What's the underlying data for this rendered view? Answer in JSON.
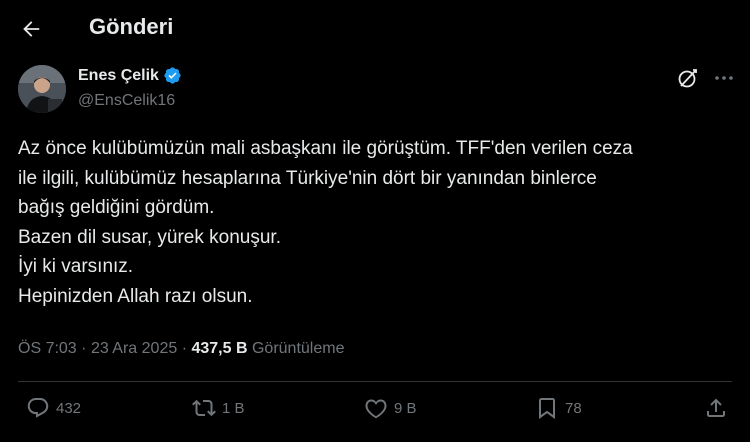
{
  "header": {
    "title": "Gönderi"
  },
  "author": {
    "name": "Enes Çelik",
    "handle": "@EnsCelik16"
  },
  "tweet": {
    "lines": [
      "Az önce kulübümüzün mali asbaşkanı ile görüştüm. TFF'den verilen ceza",
      "ile ilgili, kulübümüz hesaplarına Türkiye'nin dört bir yanından binlerce",
      "bağış geldiğini gördüm.",
      "Bazen dil susar, yürek konuşur.",
      "İyi ki varsınız.",
      "Hepinizden Allah razı olsun."
    ]
  },
  "meta": {
    "time": "ÖS 7:03",
    "separator": "·",
    "date": "23 Ara 2025",
    "views_count": "437,5 B",
    "views_label": "Görüntüleme"
  },
  "actions": {
    "replies": "432",
    "reposts": "1 B",
    "likes": "9 B",
    "bookmarks": "78"
  },
  "colors": {
    "background": "#000000",
    "text": "#e7e9ea",
    "muted": "#71767b",
    "verified": "#1d9bf0"
  }
}
